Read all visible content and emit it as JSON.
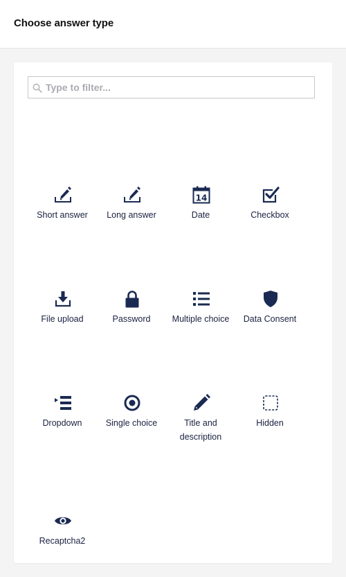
{
  "header": {
    "title": "Choose answer type"
  },
  "filter": {
    "placeholder": "Type to filter...",
    "value": ""
  },
  "colors": {
    "icon": "#1a2a52",
    "text": "#1a2140",
    "background": "#f5f4f4"
  },
  "answer_types": [
    {
      "label": "Short answer",
      "icon": "edit-box-icon"
    },
    {
      "label": "Long answer",
      "icon": "edit-box-icon"
    },
    {
      "label": "Date",
      "icon": "calendar-icon",
      "icon_text": "14"
    },
    {
      "label": "Checkbox",
      "icon": "checkbox-icon"
    },
    {
      "label": "File upload",
      "icon": "download-tray-icon"
    },
    {
      "label": "Password",
      "icon": "lock-icon"
    },
    {
      "label": "Multiple choice",
      "icon": "list-icon"
    },
    {
      "label": "Data Consent",
      "icon": "shield-icon"
    },
    {
      "label": "Dropdown",
      "icon": "dropdown-list-icon"
    },
    {
      "label": "Single choice",
      "icon": "radio-icon"
    },
    {
      "label": "Title and description",
      "icon": "pencil-icon"
    },
    {
      "label": "Hidden",
      "icon": "dashed-square-icon"
    },
    {
      "label": "Recaptcha2",
      "icon": "eye-icon"
    }
  ]
}
